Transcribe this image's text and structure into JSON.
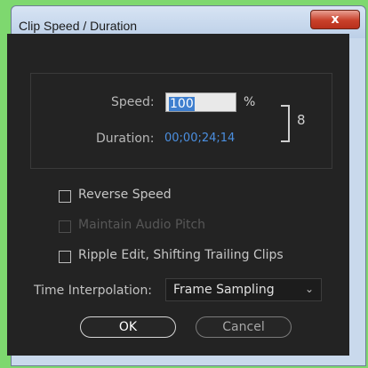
{
  "window": {
    "title": "Clip Speed / Duration",
    "close_glyph": "x"
  },
  "speed": {
    "label": "Speed:",
    "value": "100",
    "unit": "%"
  },
  "duration": {
    "label": "Duration:",
    "value": "00;00;24;14"
  },
  "link_glyph": "8",
  "options": {
    "reverse_speed": {
      "label": "Reverse Speed",
      "checked": false,
      "enabled": true
    },
    "maintain_audio_pitch": {
      "label": "Maintain Audio Pitch",
      "checked": false,
      "enabled": false
    },
    "ripple_edit": {
      "label": "Ripple Edit, Shifting Trailing Clips",
      "checked": false,
      "enabled": true
    }
  },
  "time_interpolation": {
    "label": "Time Interpolation:",
    "value": "Frame Sampling",
    "chevron": "⌄"
  },
  "buttons": {
    "ok": "OK",
    "cancel": "Cancel"
  },
  "colors": {
    "accent": "#4b8fe0",
    "selection": "#3f7fcf",
    "panel_bg": "#232323",
    "desktop_bg": "#7ed86f",
    "close_button": "#c9402a"
  },
  "icons": [
    "close-icon",
    "link-icon",
    "chevron-down-icon"
  ]
}
